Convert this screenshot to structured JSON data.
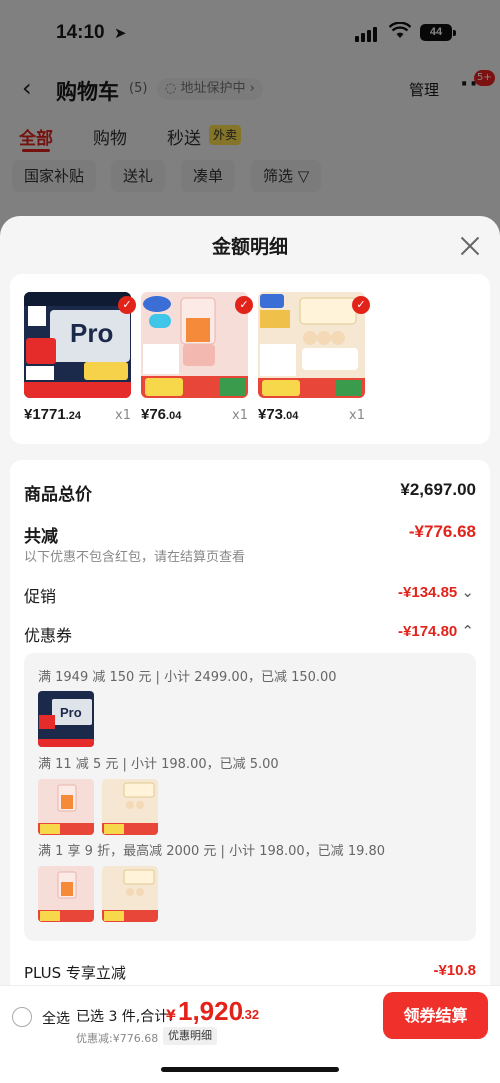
{
  "status_bar": {
    "time": "14:10",
    "battery": "44"
  },
  "nav": {
    "back_icon": "‹",
    "title": "购物车",
    "count": "(5)",
    "address": "地址保护中 ›",
    "manage": "管理",
    "more_icon": "···",
    "more_badge": "5+"
  },
  "tabs": [
    {
      "label": "全部"
    },
    {
      "label": "购物"
    },
    {
      "label": "秒送"
    }
  ],
  "tab_badge": "外卖",
  "filters": [
    {
      "label": "国家补贴"
    },
    {
      "label": "送礼"
    },
    {
      "label": "凑单"
    },
    {
      "label": "筛选 ▽"
    }
  ],
  "sheet": {
    "title": "金额明细",
    "products": [
      {
        "price_int": "¥1771",
        "price_dec": ".24",
        "qty": "x1",
        "thumb": "air-conditioner"
      },
      {
        "price_int": "¥76",
        "price_dec": ".04",
        "qty": "x1",
        "thumb": "blender"
      },
      {
        "price_int": "¥73",
        "price_dec": ".04",
        "qty": "x1",
        "thumb": "egg-cooker"
      }
    ],
    "total_label": "商品总价",
    "total_value": "¥2,697.00",
    "discount_label": "共减",
    "discount_value": "-¥776.68",
    "discount_hint": "以下优惠不包含红包，请在结算页查看",
    "promo_label": "促销",
    "promo_value": "-¥134.85",
    "promo_chevron": "⌄",
    "coupon_label": "优惠券",
    "coupon_value": "-¥174.80",
    "coupon_chevron": "⌃",
    "coupon_rules": [
      {
        "text": "满 1949 减 150 元 | 小计 2499.00，已减 150.00"
      },
      {
        "text": "满 11 减 5 元 | 小计 198.00，已减 5.00"
      },
      {
        "text": "满 1 享 9 折，最高减 2000 元 | 小计 198.00，已减 19.80"
      }
    ],
    "plus_label": "PLUS 专享立减",
    "plus_value": "-¥10.8"
  },
  "bottom": {
    "select_all": "全选",
    "picked": "已选 3 件,合计:",
    "currency": "¥",
    "total_int": "1,920",
    "total_dec": ".32",
    "saving": "优惠减:¥776.68",
    "detail_tag": "优惠明细",
    "checkout": "领券结算"
  },
  "colors": {
    "accent": "#e2231a",
    "checkout": "#f0302a"
  }
}
